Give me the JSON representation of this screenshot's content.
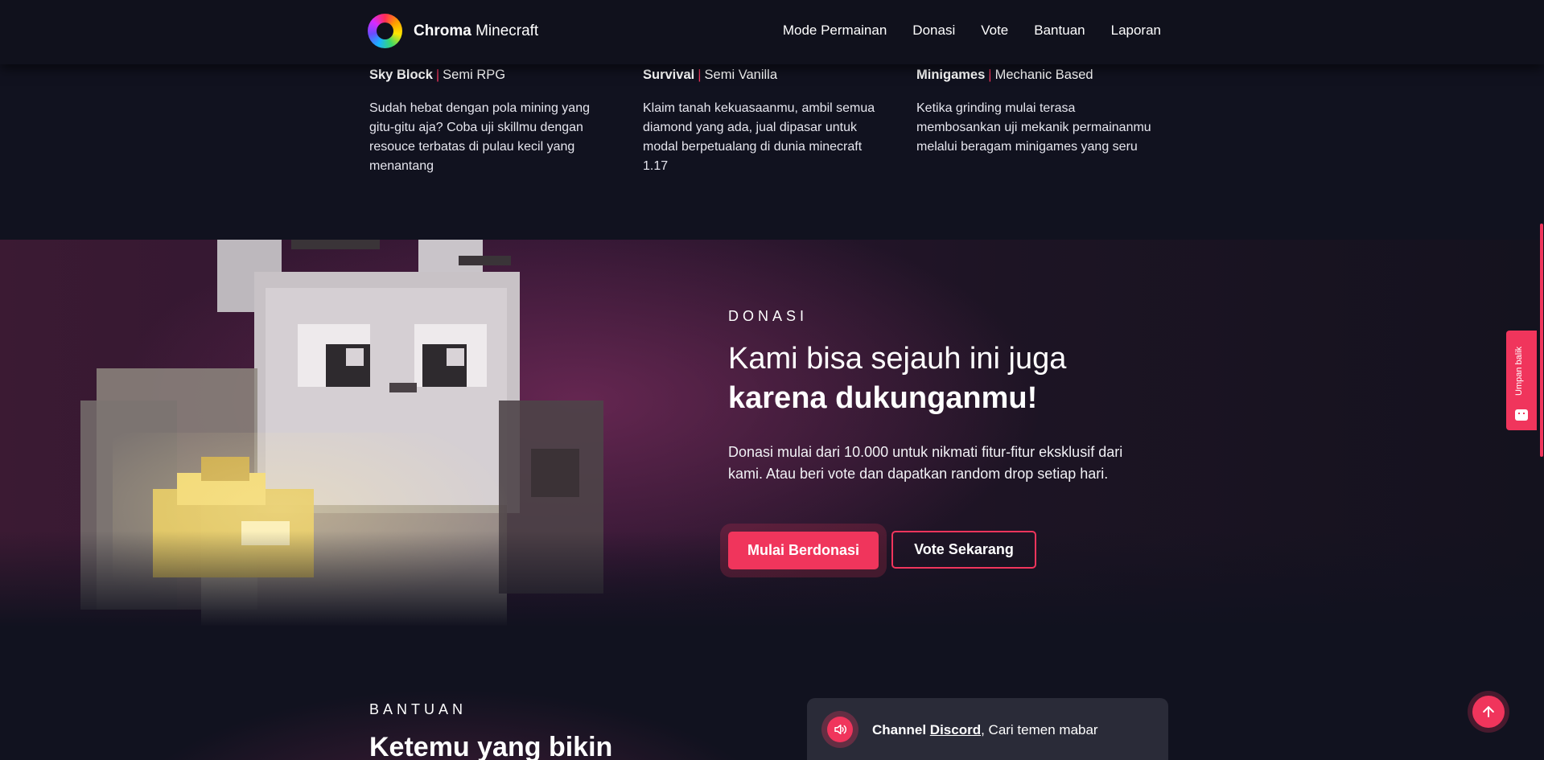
{
  "brand": {
    "name_bold": "Chroma",
    "name_rest": "Minecraft"
  },
  "nav": {
    "items": [
      "Mode Permainan",
      "Donasi",
      "Vote",
      "Bantuan",
      "Laporan"
    ]
  },
  "modes": [
    {
      "name": "Sky Block",
      "tag": "Semi RPG",
      "desc": "Sudah hebat dengan pola mining yang gitu-gitu aja? Coba uji skillmu dengan resouce terbatas di pulau kecil yang menantang"
    },
    {
      "name": "Survival",
      "tag": "Semi Vanilla",
      "desc": "Klaim tanah kekuasaanmu, ambil semua diamond yang ada, jual dipasar untuk modal berpetualang di dunia minecraft 1.17"
    },
    {
      "name": "Minigames",
      "tag": "Mechanic Based",
      "desc": "Ketika grinding mulai terasa membosankan uji mekanik permainanmu melalui beragam minigames yang seru"
    }
  ],
  "hero": {
    "label": "DONASI",
    "title_line1": "Kami bisa sejauh ini juga",
    "title_line2": "karena dukunganmu!",
    "desc": "Donasi mulai dari 10.000 untuk nikmati fitur-fitur eksklusif dari kami. Atau beri vote dan dapatkan random drop setiap hari.",
    "primary_button": "Mulai Berdonasi",
    "secondary_button": "Vote Sekarang"
  },
  "bantuan": {
    "label": "BANTUAN",
    "title": "Ketemu yang bikin",
    "card": {
      "prefix": "Channel",
      "link": "Discord",
      "suffix": ", Cari temen mabar"
    }
  },
  "feedback": {
    "label": "Umpan balik"
  },
  "icons": {
    "logo": "chroma-logo",
    "discord": "speaker-icon",
    "to_top": "arrow-up-icon",
    "feedback": "chat-face-icon"
  },
  "colors": {
    "accent": "#f0355c",
    "background": "#11121f",
    "card": "#2a2b38"
  }
}
